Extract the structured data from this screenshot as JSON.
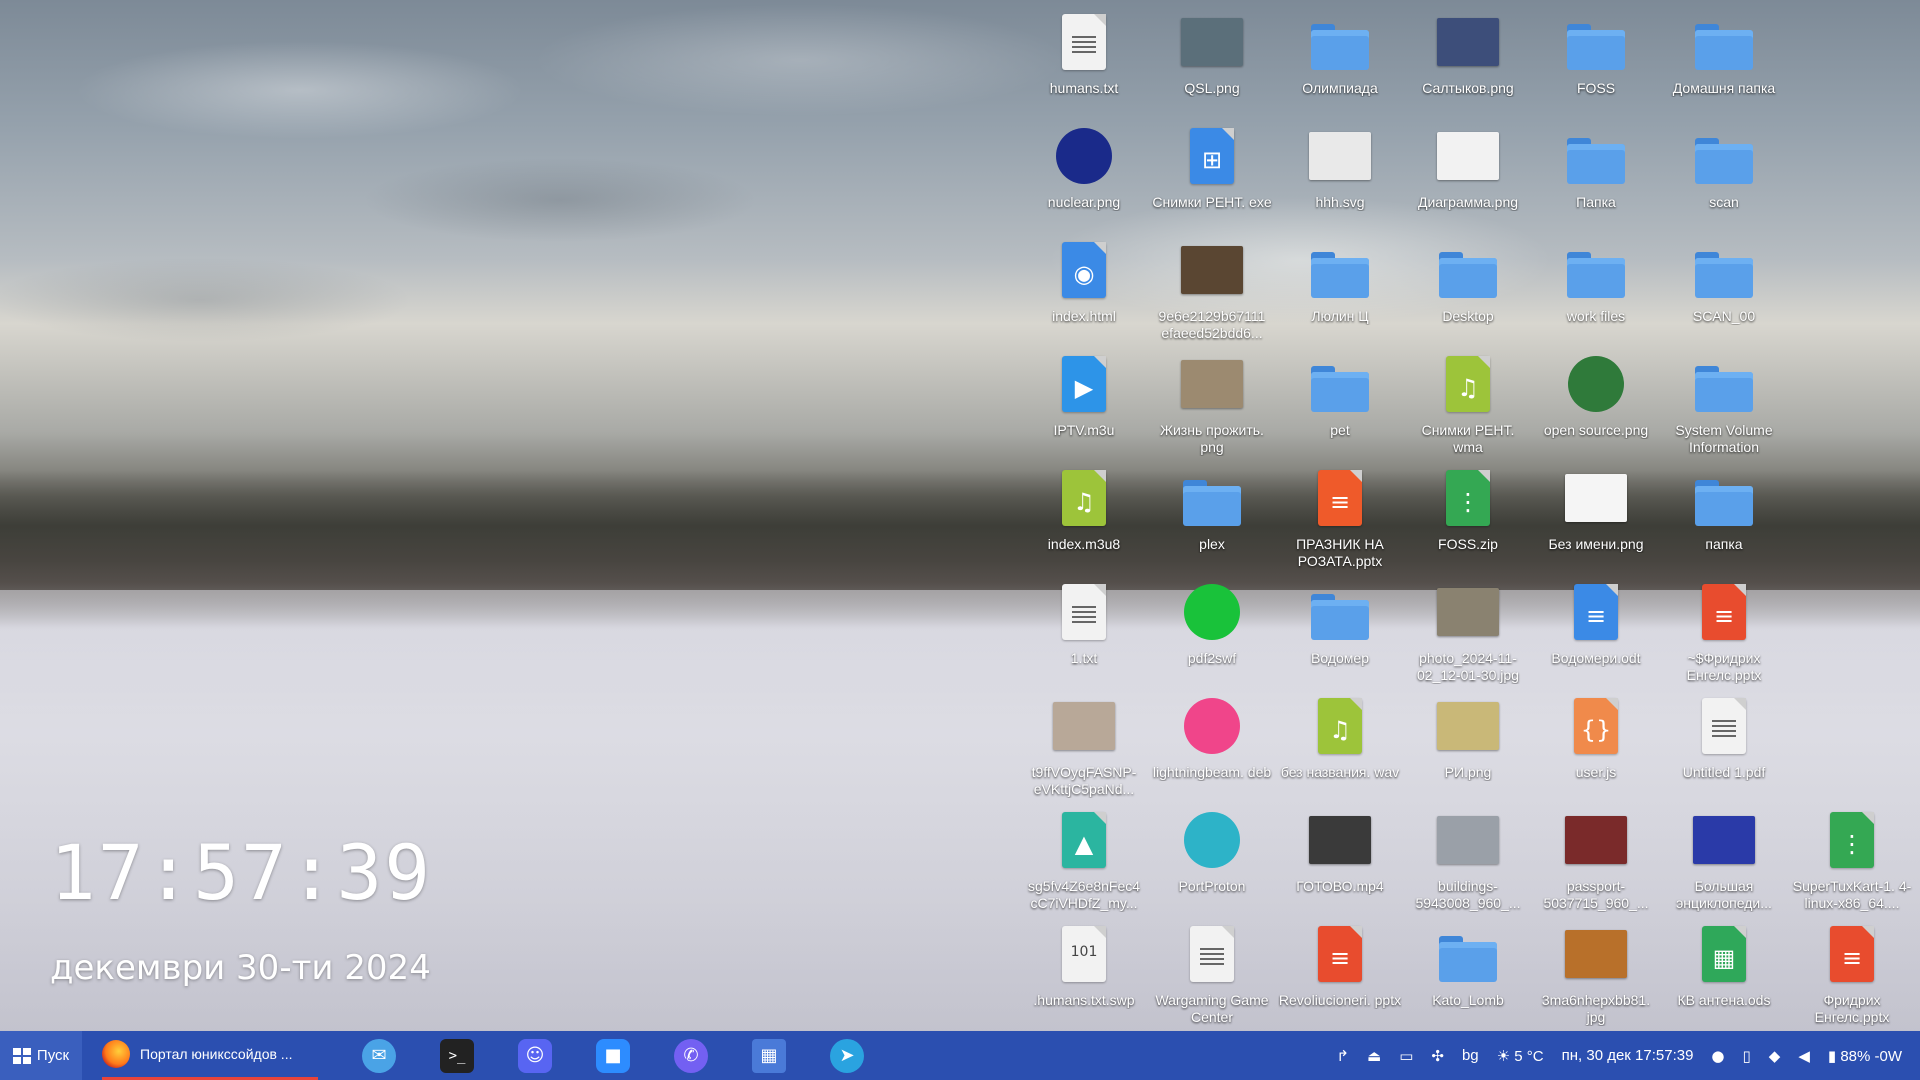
{
  "clock": {
    "time": "17:57:39",
    "date": "декември 30-ти 2024"
  },
  "desktop_icons": [
    {
      "label": "humans.txt",
      "kind": "doc"
    },
    {
      "label": "QSL.png",
      "kind": "thumb",
      "color": "#5b6f7a"
    },
    {
      "label": "Олимпиада",
      "kind": "folder"
    },
    {
      "label": "Салтыков.png",
      "kind": "thumb",
      "color": "#3d4e7a"
    },
    {
      "label": "FOSS",
      "kind": "folder"
    },
    {
      "label": "Домашня папка",
      "kind": "folder"
    },
    {
      "label": "",
      "kind": "none"
    },
    {
      "label": "nuclear.png",
      "kind": "circle",
      "color": "#1a2a8a"
    },
    {
      "label": "Снимки РЕНТ. exe",
      "kind": "doc",
      "style": "blue",
      "sym": "⊞"
    },
    {
      "label": "hhh.svg",
      "kind": "thumb",
      "color": "#e9e9e9"
    },
    {
      "label": "Диаграмма.png",
      "kind": "thumb",
      "color": "#f2f2f2"
    },
    {
      "label": "Папка",
      "kind": "folder"
    },
    {
      "label": "scan",
      "kind": "folder"
    },
    {
      "label": "",
      "kind": "none"
    },
    {
      "label": "index.html",
      "kind": "doc",
      "style": "globe",
      "sym": "◉"
    },
    {
      "label": "9e6e2129b67111 efaeed52bdd6...",
      "kind": "thumb",
      "color": "#5a4632"
    },
    {
      "label": "Люлин Ц",
      "kind": "folder"
    },
    {
      "label": "Desktop",
      "kind": "folder"
    },
    {
      "label": "work files",
      "kind": "folder"
    },
    {
      "label": "SCAN_00",
      "kind": "folder"
    },
    {
      "label": "",
      "kind": "none"
    },
    {
      "label": "IPTV.m3u",
      "kind": "doc",
      "style": "play",
      "sym": "▶"
    },
    {
      "label": "Жизнь прожить. png",
      "kind": "thumb",
      "color": "#9c8a70"
    },
    {
      "label": "pet",
      "kind": "folder"
    },
    {
      "label": "Снимки РЕНТ. wma",
      "kind": "doc",
      "style": "green",
      "sym": "♫"
    },
    {
      "label": "open source.png",
      "kind": "circle",
      "color": "#2f7a3a"
    },
    {
      "label": "System Volume Information",
      "kind": "folder"
    },
    {
      "label": "",
      "kind": "none"
    },
    {
      "label": "index.m3u8",
      "kind": "doc",
      "style": "green",
      "sym": "♫"
    },
    {
      "label": "plex",
      "kind": "folder"
    },
    {
      "label": "ПРАЗНИК НА РОЗАТА.pptx",
      "kind": "doc",
      "style": "orange",
      "sym": "≡"
    },
    {
      "label": "FOSS.zip",
      "kind": "doc",
      "style": "zip",
      "sym": "⋮"
    },
    {
      "label": "Без имени.png",
      "kind": "thumb",
      "color": "#f5f5f5"
    },
    {
      "label": "папка",
      "kind": "folder"
    },
    {
      "label": "",
      "kind": "none"
    },
    {
      "label": "1.txt",
      "kind": "doc"
    },
    {
      "label": "pdf2swf",
      "kind": "circle",
      "color": "#19c23a"
    },
    {
      "label": "Водомер",
      "kind": "folder"
    },
    {
      "label": "photo_2024-11- 02_12-01-30.jpg",
      "kind": "thumb",
      "color": "#8a8270"
    },
    {
      "label": "Водомери.odt",
      "kind": "doc",
      "style": "blue",
      "sym": "≡"
    },
    {
      "label": "~$Фридрих Енгелс.pptx",
      "kind": "doc",
      "style": "red",
      "sym": "≡"
    },
    {
      "label": "",
      "kind": "none"
    },
    {
      "label": "t9ffVOyqFASNP- eVKttjC5paNd...",
      "kind": "thumb",
      "color": "#b8a898"
    },
    {
      "label": "lightningbeam. deb",
      "kind": "circle",
      "color": "#f0458a"
    },
    {
      "label": "без названия. wav",
      "kind": "doc",
      "style": "green",
      "sym": "♫"
    },
    {
      "label": "РИ.png",
      "kind": "thumb",
      "color": "#c9b878"
    },
    {
      "label": "user.js",
      "kind": "doc",
      "style": "json",
      "sym": "{}"
    },
    {
      "label": "Untitled 1.pdf",
      "kind": "doc"
    },
    {
      "label": "",
      "kind": "none"
    },
    {
      "label": "sg5fv4Z6e8nFec4 cC7iVHDfZ_my...",
      "kind": "doc",
      "style": "img",
      "sym": "▲"
    },
    {
      "label": "PortProton",
      "kind": "circle",
      "color": "#2db3c8"
    },
    {
      "label": "ГОТОВО.mp4",
      "kind": "thumb",
      "color": "#3a3a3a"
    },
    {
      "label": "buildings- 5943008_960_...",
      "kind": "thumb",
      "color": "#9aa0a8"
    },
    {
      "label": "passport- 5037715_960_...",
      "kind": "thumb",
      "color": "#7a2a2a"
    },
    {
      "label": "Большая энциклопеди...",
      "kind": "thumb",
      "color": "#2a3aa8"
    },
    {
      "label": "SuperTuxKart-1. 4-linux-x86_64....",
      "kind": "doc",
      "style": "zip",
      "sym": "⋮"
    },
    {
      "label": ".humans.txt.swp",
      "kind": "doc",
      "sym": "101"
    },
    {
      "label": "Wargaming Game Center",
      "kind": "doc"
    },
    {
      "label": "Revoliucioneri. pptx",
      "kind": "doc",
      "style": "red",
      "sym": "≡"
    },
    {
      "label": "Kato_Lomb",
      "kind": "folder"
    },
    {
      "label": "3ma6nhepxbb81. jpg",
      "kind": "thumb",
      "color": "#b8702a"
    },
    {
      "label": "КВ антена.ods",
      "kind": "doc",
      "style": "sheet",
      "sym": "▦"
    },
    {
      "label": "Фридрих Енгелс.pptx",
      "kind": "doc",
      "style": "red",
      "sym": "≡"
    }
  ],
  "taskbar": {
    "start_label": "Пуск",
    "firefox_title": "Портал юникссойдов ...",
    "tray": {
      "lang": "bg",
      "weather": "5 °C",
      "datetime": "пн, 30 дек  17:57:39",
      "battery": "88% -0W"
    }
  }
}
